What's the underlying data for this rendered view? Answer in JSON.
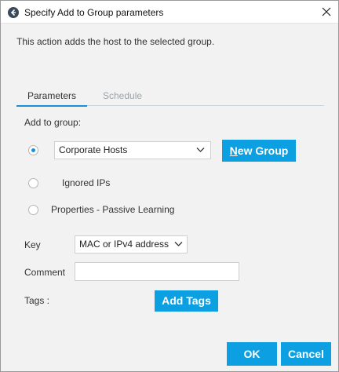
{
  "window": {
    "title": "Specify Add to Group parameters"
  },
  "description": "This action adds the host to the selected group.",
  "tabs": [
    {
      "label": "Parameters"
    },
    {
      "label": "Schedule"
    }
  ],
  "form": {
    "add_to_group_label": "Add to group:",
    "group_select_value": "Corporate Hosts",
    "new_group_mnemonic": "N",
    "new_group_rest": "ew Group",
    "options": [
      {
        "label": "Ignored IPs"
      },
      {
        "label": "Properties - Passive Learning"
      }
    ],
    "key_label": "Key",
    "key_select_value": "MAC or IPv4 address",
    "comment_label": "Comment",
    "comment_value": "",
    "tags_label": "Tags :",
    "add_tags_label": "Add Tags"
  },
  "footer": {
    "ok_label": "OK",
    "cancel_label": "Cancel"
  },
  "colors": {
    "accent": "#0ca0e2",
    "tab_underline": "#1a8fd8"
  }
}
